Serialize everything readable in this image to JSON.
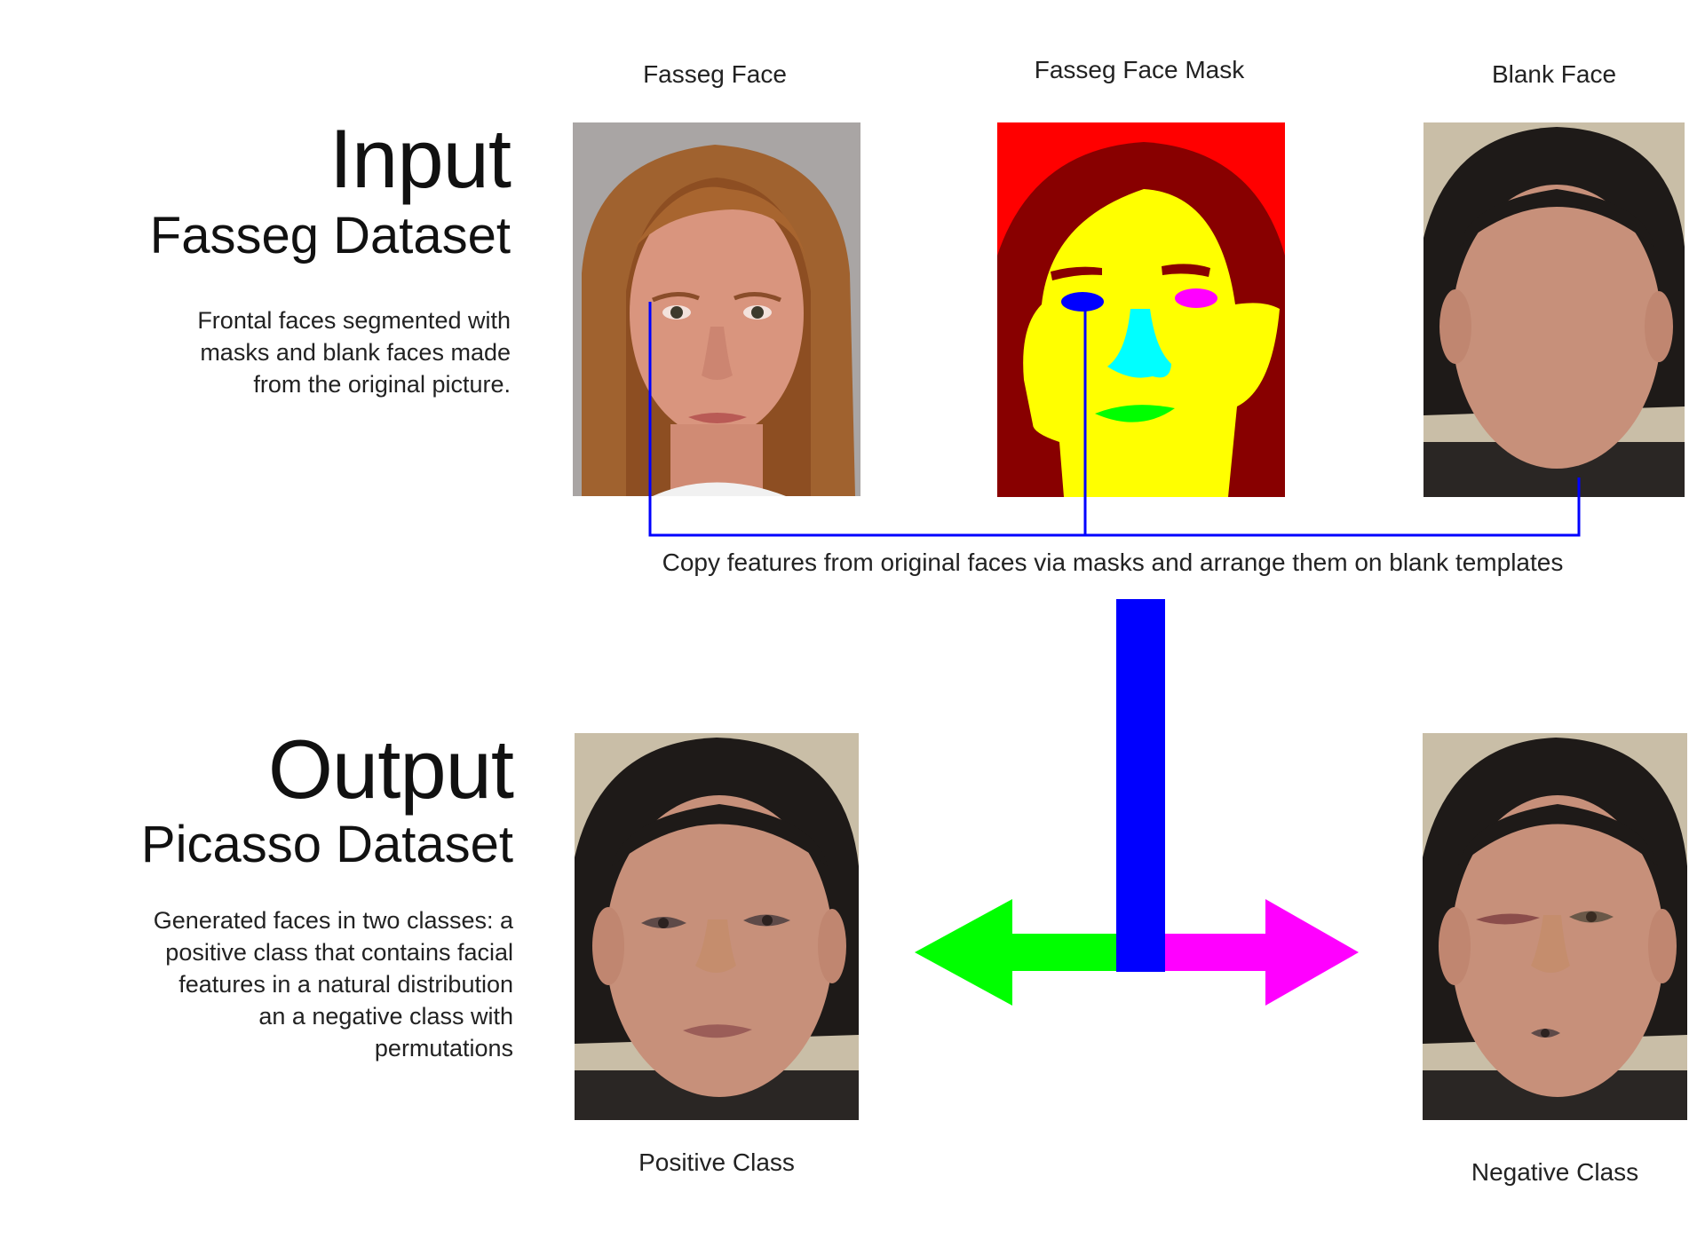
{
  "input_section": {
    "title": "Input",
    "subtitle": "Fasseg Dataset",
    "description_lines": [
      "Frontal faces segmented with",
      "masks and blank faces made",
      "from the original picture."
    ]
  },
  "output_section": {
    "title": "Output",
    "subtitle": "Picasso Dataset",
    "description_lines": [
      "Generated faces in two classes: a",
      "positive class that contains facial",
      "features in a natural distribution",
      "an a negative class with",
      "permutations"
    ]
  },
  "captions": {
    "fasseg_face": "Fasseg Face",
    "fasseg_mask": "Fasseg Face Mask",
    "blank_face": "Blank Face",
    "copy_step": "Copy features from original faces via masks and arrange them on blank templates",
    "positive_class": "Positive Class",
    "negative_class": "Negative Class"
  },
  "colors": {
    "connector_blue": "#0000ff",
    "arrow_green": "#00ff00",
    "arrow_magenta": "#ff00ff",
    "mask_background_red": "#ff0000",
    "mask_hair_maroon": "#880000",
    "mask_skin_yellow": "#ffff00",
    "mask_eye_blue": "#0000ff",
    "mask_eye_magenta": "#ff00ff",
    "mask_nose_cyan": "#00ffff",
    "mask_mouth_green": "#00ff00"
  }
}
